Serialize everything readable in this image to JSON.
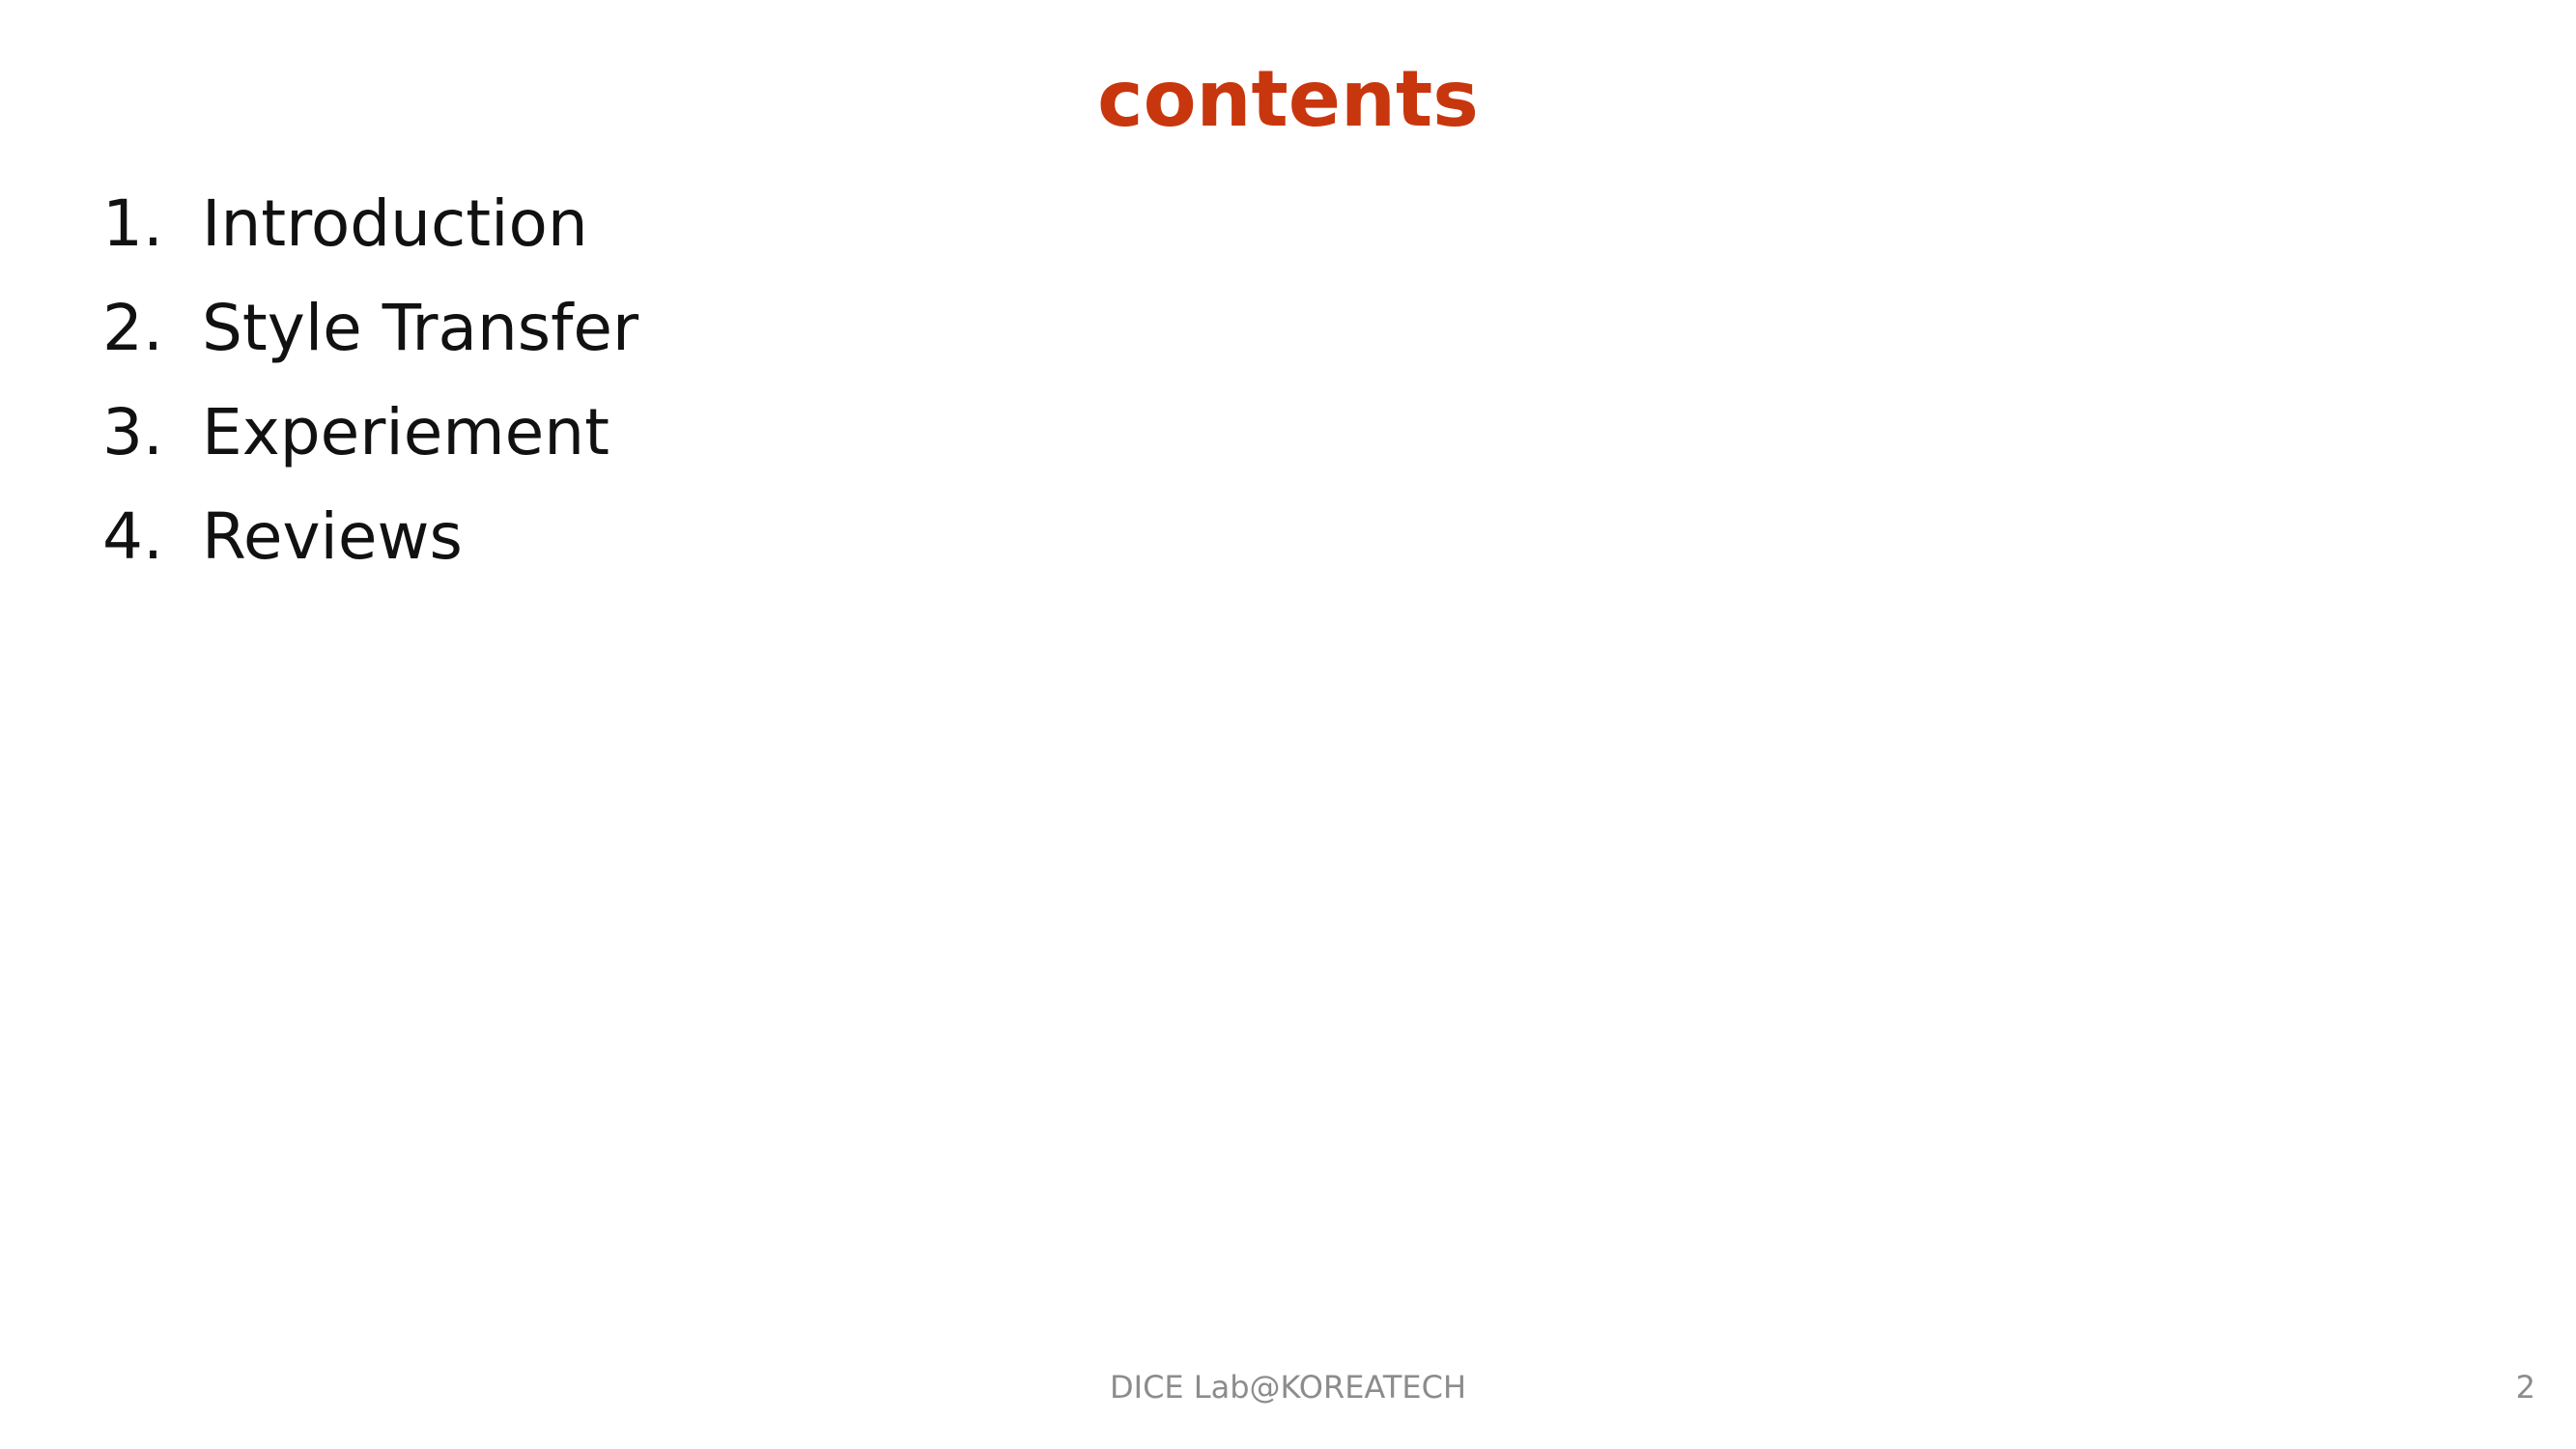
{
  "slide": {
    "title": "contents",
    "items": [
      {
        "number": "1.",
        "label": "Introduction"
      },
      {
        "number": "2.",
        "label": "Style Transfer"
      },
      {
        "number": "3.",
        "label": "Experiement"
      },
      {
        "number": "4.",
        "label": "Reviews"
      }
    ],
    "footer": "DICE Lab@KOREATECH",
    "page_number": "2"
  },
  "colors": {
    "title": "#c8360e",
    "body_text": "#111111",
    "footer_text": "#8c8c8c",
    "background": "#ffffff"
  }
}
